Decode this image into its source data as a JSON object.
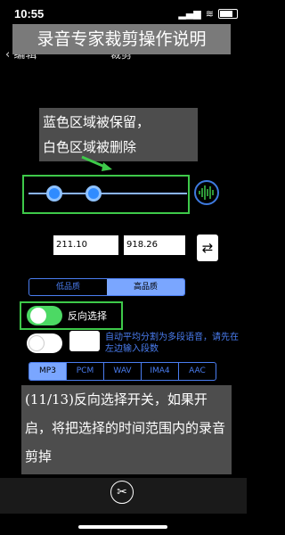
{
  "status": {
    "time": "10:55",
    "signal": "▂▄▆",
    "wifi": "≋"
  },
  "nav": {
    "back_label": "编辑",
    "title": "裁剪"
  },
  "banners": {
    "top": "录音专家裁剪操作说明",
    "hint_line1": "蓝色区域被保留，",
    "hint_line2": "白色区域被删除",
    "bottom": "(11/13)反向选择开关，如果开启，将把选择的时间范围内的录音剪掉"
  },
  "times": {
    "start": "211.10",
    "end": "918.26"
  },
  "swap_icon": "⇄",
  "quality": {
    "options": [
      "低品质",
      "高品质"
    ],
    "selected": "高品质"
  },
  "reverse": {
    "label": "反向选择",
    "on": true
  },
  "split": {
    "hint": "自动平均分割为多段语音，请先在左边输入段数",
    "on": false
  },
  "formats": {
    "options": [
      "MP3",
      "PCM",
      "WAV",
      "IMA4",
      "AAC"
    ],
    "selected": "MP3"
  },
  "colors": {
    "accent": "#4a7df0",
    "highlight": "#3ec94a",
    "switch_on": "#4cd964"
  },
  "icons": {
    "back": "chevron-left-icon",
    "waveform": "waveform-icon",
    "cut": "scissors-icon"
  }
}
